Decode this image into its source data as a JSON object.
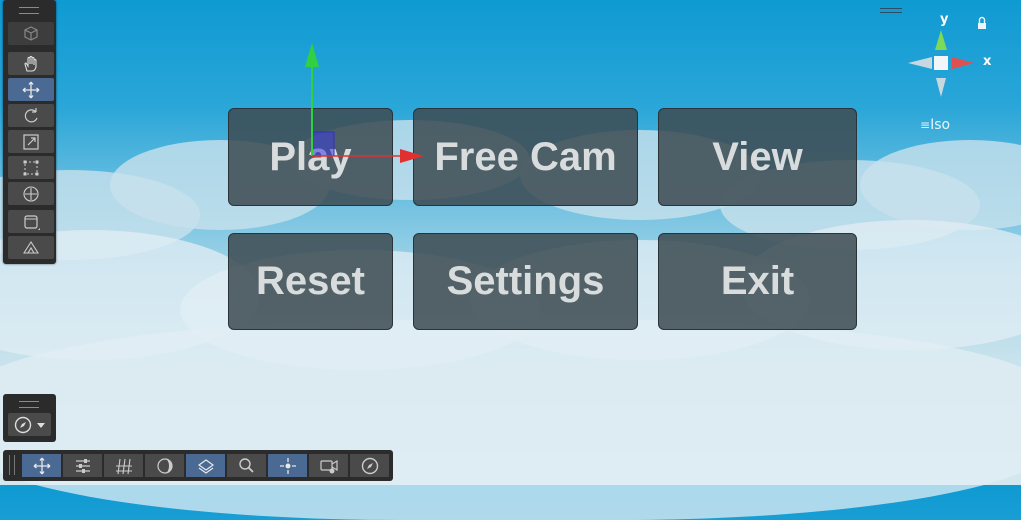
{
  "menu": {
    "buttons": [
      {
        "label": "Play"
      },
      {
        "label": "Free Cam"
      },
      {
        "label": "View"
      },
      {
        "label": "Reset"
      },
      {
        "label": "Settings"
      },
      {
        "label": "Exit"
      }
    ]
  },
  "scene_gizmo": {
    "y_label": "y",
    "x_label": "x",
    "projection_label": "Iso",
    "projection_icon": "menu-lines-icon",
    "lock_icon": "lock-icon"
  },
  "tool_palette": {
    "tools": [
      {
        "icon": "cube-icon"
      },
      {
        "icon": "hand-icon"
      },
      {
        "icon": "move-icon",
        "active": true
      },
      {
        "icon": "rotate-icon"
      },
      {
        "icon": "scale-icon"
      },
      {
        "icon": "rect-icon"
      },
      {
        "icon": "transform-icon"
      },
      {
        "icon": "custom-tool-icon"
      },
      {
        "icon": "probuilder-icon"
      }
    ]
  },
  "orientation": {
    "icon": "compass-icon"
  },
  "bottom_toolbar": {
    "items": [
      {
        "icon": "move-icon",
        "active": true
      },
      {
        "icon": "sliders-icon"
      },
      {
        "icon": "grid-icon"
      },
      {
        "icon": "lighting-icon"
      },
      {
        "icon": "layers-icon",
        "active": true
      },
      {
        "icon": "search-icon"
      },
      {
        "icon": "pivot-icon",
        "active": true
      },
      {
        "icon": "camera-icon"
      },
      {
        "icon": "compass-icon"
      }
    ]
  },
  "colors": {
    "sky_top": "#0f9ad2",
    "sky_bottom": "#d3e7ee",
    "button_bg": "#3c4b52",
    "button_text": "#d9dcdd",
    "active_tool": "#4a6a93",
    "axis_x": "#e03030",
    "axis_y": "#30d040"
  }
}
